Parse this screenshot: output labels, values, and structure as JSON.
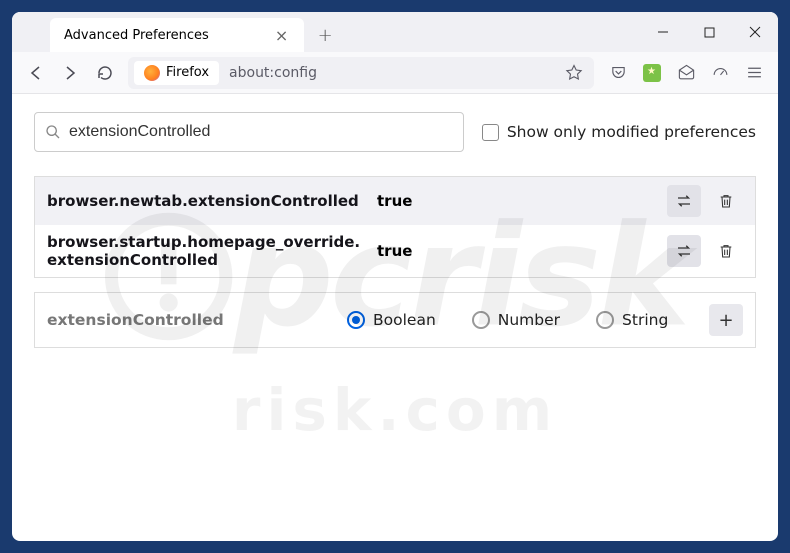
{
  "tab": {
    "title": "Advanced Preferences"
  },
  "urlbar": {
    "identity_label": "Firefox",
    "url": "about:config"
  },
  "search": {
    "value": "extensionControlled"
  },
  "modified_only": {
    "label": "Show only modified preferences"
  },
  "prefs": [
    {
      "name": "browser.newtab.extensionControlled",
      "value": "true"
    },
    {
      "name": "browser.startup.homepage_override.extensionControlled",
      "value": "true"
    }
  ],
  "new_pref": {
    "name": "extensionControlled",
    "types": [
      "Boolean",
      "Number",
      "String"
    ],
    "selected_index": 0
  },
  "watermark": {
    "main": "pcrisk",
    "sub": "risk.com"
  }
}
